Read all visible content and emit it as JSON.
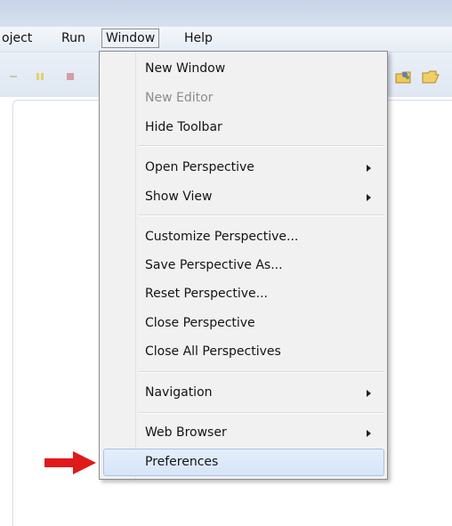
{
  "menubar": {
    "items": [
      {
        "label": "oject"
      },
      {
        "label": "Run"
      },
      {
        "label": "Window",
        "active": true
      },
      {
        "label": "Help"
      }
    ]
  },
  "toolbar": {
    "icons": [
      "resume-icon",
      "suspend-icon",
      "terminate-icon",
      "open-type-icon",
      "open-folder-icon"
    ]
  },
  "window_menu": {
    "items": [
      {
        "label": "New Window",
        "enabled": true
      },
      {
        "label": "New Editor",
        "enabled": false
      },
      {
        "label": "Hide Toolbar",
        "enabled": true
      },
      {
        "label": "Open Perspective",
        "enabled": true,
        "submenu": true
      },
      {
        "label": "Show View",
        "enabled": true,
        "submenu": true
      },
      {
        "label": "Customize Perspective...",
        "enabled": true
      },
      {
        "label": "Save Perspective As...",
        "enabled": true
      },
      {
        "label": "Reset Perspective...",
        "enabled": true
      },
      {
        "label": "Close Perspective",
        "enabled": true
      },
      {
        "label": "Close All Perspectives",
        "enabled": true
      },
      {
        "label": "Navigation",
        "enabled": true,
        "submenu": true
      },
      {
        "label": "Web Browser",
        "enabled": true,
        "submenu": true
      },
      {
        "label": "Preferences",
        "enabled": true,
        "highlighted": true
      }
    ]
  },
  "colors": {
    "arrow": "#e01a1a",
    "highlight": "#d6e5f8"
  }
}
